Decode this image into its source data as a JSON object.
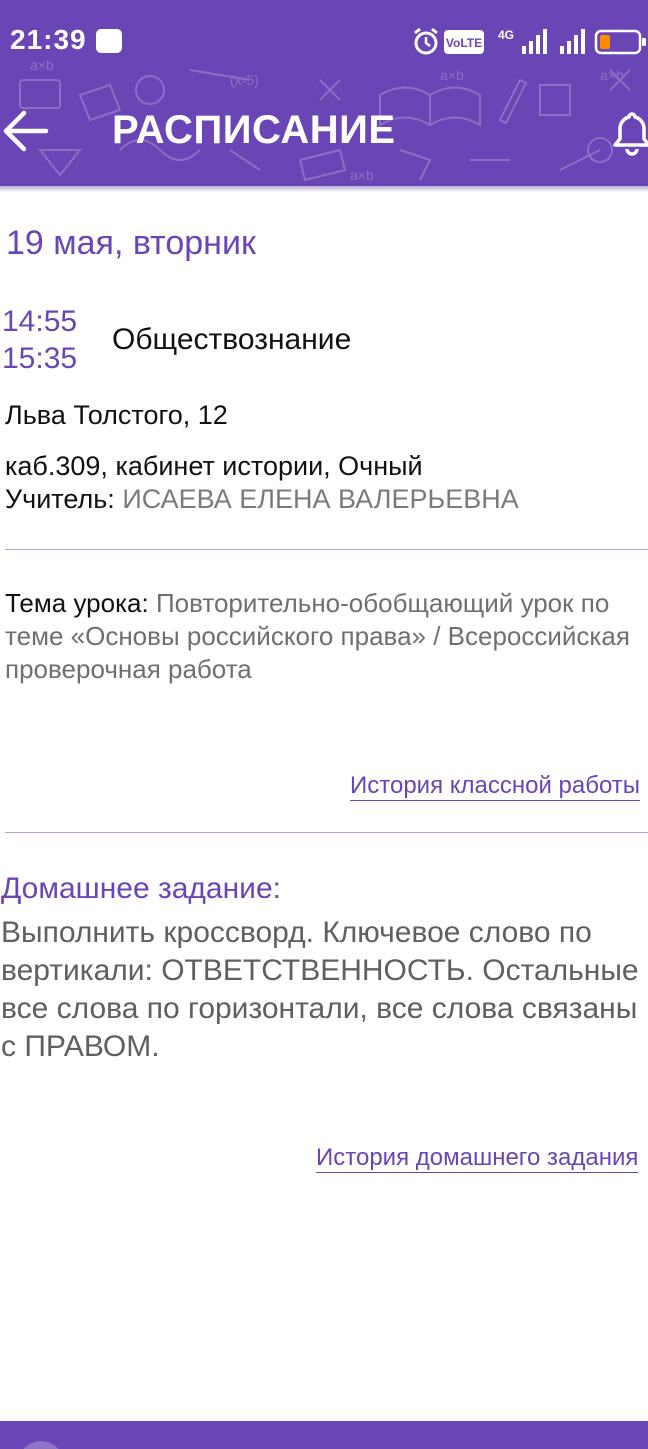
{
  "status_bar": {
    "time": "21:39",
    "icons": [
      "app-notification-icon",
      "alarm-icon",
      "volte-icon",
      "signal-4g-icon",
      "signal-icon",
      "battery-low-icon"
    ],
    "volte_label": "VoLTE",
    "network_label": "4G"
  },
  "app_bar": {
    "title": "РАСПИСАНИЕ",
    "back_icon": "arrow-left-icon",
    "bell_icon": "bell-icon",
    "background": "#6a45b5"
  },
  "lesson": {
    "date": "19 мая, вторник",
    "time_start": "14:55",
    "time_end": "15:35",
    "subject": "Обществознание",
    "address": "Льва Толстого, 12",
    "room": "каб.309, кабинет истории, Очный",
    "teacher_label": "Учитель:",
    "teacher_name": "ИСАЕВА ЕЛЕНА ВАЛЕРЬЕВНА",
    "topic_label": "Тема урока:",
    "topic_text": "Повторительно-обобщающий урок по теме «Основы российского права» / Всероссийская проверочная работа",
    "class_history_link": "История классной работы"
  },
  "homework": {
    "heading": "Домашнее задание:",
    "text": "Выполнить кроссворд. Ключевое слово по вертикали: ОТВЕТСТВЕННОСТЬ. Остальные все слова по горизонтали, все слова связаны с ПРАВОМ.",
    "history_link": "История домашнего задания"
  },
  "colors": {
    "accent": "#6a45b5",
    "divider": "#b89fd8",
    "muted_text": "#6f6f6f"
  }
}
